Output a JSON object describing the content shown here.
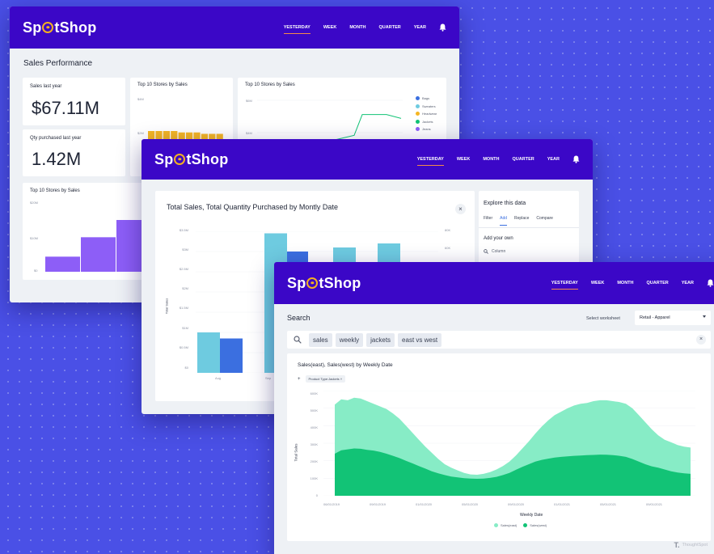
{
  "colors": {
    "background": "#4a50e6",
    "topbar": "#3b07c7",
    "logo_accent": "#f3b021",
    "active_underline": "#f38a4a",
    "purple_bar": "#8d5ef7",
    "yellow_bar": "#f5b623",
    "teal_bar": "#6ecbe0",
    "blue_bar": "#3b6fe0",
    "east_area": "#87ecc6",
    "west_area": "#12c376"
  },
  "brand": {
    "logo_prefix": "Sp",
    "logo_suffix": "tShop"
  },
  "nav": [
    "YESTERDAY",
    "WEEK",
    "MONTH",
    "QUARTER",
    "YEAR"
  ],
  "icons": {
    "notifications": "bell-icon",
    "search": "search-icon",
    "close": "close-icon",
    "filter": "filter-icon",
    "dropdown": "chevron-down-icon",
    "watermark": "thoughtspot-logo"
  },
  "win1": {
    "page_title": "Sales Performance",
    "kpi1": {
      "label": "Sales last year",
      "value": "$67.11M"
    },
    "kpi2": {
      "label": "Qty purchased last year",
      "value": "1.42M"
    },
    "chart_a": {
      "title": "Top 10 Stores by Sales",
      "ticks": [
        "$4M",
        "$2M"
      ]
    },
    "chart_b": {
      "title": "Top 10 Stores by Sales",
      "ticks": [
        "$6M",
        "$4M"
      ],
      "legend": [
        "Bags",
        "Sweaters",
        "Headwear",
        "Jackets",
        "Jeans"
      ],
      "legend_colors": [
        "#3b6fe0",
        "#6ecbe0",
        "#f5b623",
        "#12c376",
        "#8d5ef7"
      ]
    },
    "chart_c": {
      "title": "Top 10 Stores by Sales",
      "ticks": [
        "$20M",
        "$10M",
        "$0"
      ]
    }
  },
  "win2": {
    "chart_title": "Total Sales, Total Quantity Purchased by Montly Date",
    "y_label": "Total Sales",
    "y_ticks": [
      "$3.5M",
      "$3M",
      "$2.5M",
      "$2M",
      "$1.5M",
      "$1M",
      "$0.5M",
      "$0"
    ],
    "y2_ticks": [
      "80K",
      "60K",
      "40K"
    ],
    "x_ticks": [
      "Aug",
      "Sep"
    ],
    "panel": {
      "title": "Explore this data",
      "tabs": [
        "Filter",
        "Add",
        "Replace",
        "Compare"
      ],
      "active_tab": "Add",
      "section": "Add your own",
      "search_placeholder": "Column"
    }
  },
  "win3": {
    "search_label": "Search",
    "worksheet_label": "Select worksheet",
    "worksheet_value": "Retail - Apparel",
    "tokens": [
      "sales",
      "weekly",
      "jackets",
      "east vs west"
    ],
    "chart_title": "Sales(east), Sales(west) by Weekly Date",
    "filter_chip": "Product Type:Jackets",
    "y_label": "Total Sales",
    "y_ticks": [
      "600K",
      "500K",
      "400K",
      "300K",
      "200K",
      "100K",
      "0"
    ],
    "x_ticks": [
      "06/01/2019",
      "09/01/2019",
      "01/01/2020",
      "05/01/2020",
      "09/01/2020",
      "01/01/2021",
      "05/01/2021",
      "09/01/2021"
    ],
    "x_label": "Weekly Date",
    "legend": [
      "Sales(east)",
      "Sales(west)"
    ]
  },
  "watermark": "ThoughtSpot",
  "chart_data": [
    {
      "type": "bar",
      "title": "Top 10 Stores by Sales",
      "values": [
        2.4,
        2.4,
        2.4,
        2.4,
        2.3,
        2.3,
        2.3,
        2.2,
        2.2,
        2.2
      ],
      "ylim": [
        0,
        4
      ]
    },
    {
      "type": "line",
      "title": "Top 10 Stores by Sales",
      "values": [
        3.5,
        3.8,
        4.9,
        4.9,
        4.7
      ],
      "ylim": [
        3,
        6
      ]
    },
    {
      "type": "bar",
      "title": "Top 10 Stores by Sales",
      "values": [
        7,
        16,
        24,
        25,
        25
      ],
      "ylim": [
        0,
        30
      ]
    },
    {
      "type": "bar",
      "title": "Total Sales, Total Quantity Purchased by Montly Date",
      "ylabel": "Total Sales",
      "series": [
        {
          "values": [
            1.0,
            3.45,
            3.1,
            1.5
          ]
        },
        {
          "values": [
            0.85,
            2.4,
            2.05,
            0.9
          ]
        }
      ],
      "series_extra": [
        {
          "values": [
            1.3,
            3.2,
            2.6
          ]
        },
        {
          "values": [
            3.0,
            2.6,
            2.5,
            2.5
          ]
        }
      ],
      "ylim": [
        0,
        3.5
      ]
    },
    {
      "type": "area",
      "title": "Sales(east), Sales(west) by Weekly Date",
      "xlabel": "Weekly Date",
      "ylabel": "Total Sales",
      "ylim": [
        0,
        600
      ],
      "series": [
        {
          "name": "Sales(east)",
          "values": [
            520,
            550,
            545,
            560,
            555,
            540,
            525,
            510,
            495,
            470,
            440,
            400,
            360,
            320,
            280,
            245,
            210,
            180,
            160,
            145,
            130,
            122,
            120,
            125,
            135,
            150,
            170,
            195,
            230,
            270,
            310,
            355,
            395,
            430,
            460,
            480,
            500,
            515,
            525,
            530,
            540,
            545,
            545,
            540,
            535,
            525,
            500,
            460,
            420,
            380,
            345,
            320,
            305,
            290,
            280,
            275
          ]
        },
        {
          "name": "Sales(west)",
          "values": [
            240,
            260,
            265,
            270,
            268,
            262,
            258,
            250,
            240,
            228,
            215,
            200,
            185,
            170,
            155,
            140,
            128,
            118,
            110,
            105,
            100,
            98,
            97,
            98,
            102,
            108,
            118,
            130,
            148,
            165,
            180,
            195,
            205,
            212,
            218,
            222,
            225,
            228,
            230,
            232,
            233,
            235,
            234,
            232,
            228,
            222,
            210,
            195,
            180,
            168,
            160,
            150,
            140,
            133,
            128,
            125
          ]
        }
      ]
    }
  ]
}
